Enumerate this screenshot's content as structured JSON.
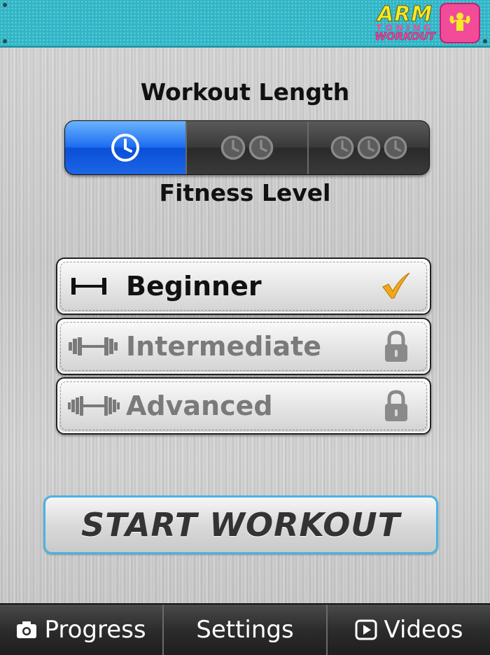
{
  "app": {
    "logo": {
      "line1": "ARM",
      "line2": "TONING",
      "line3": "WORKOUT"
    }
  },
  "workout_length": {
    "title": "Workout Length",
    "options": [
      {
        "icon": "clock-icon",
        "clocks": 1,
        "selected": true
      },
      {
        "icon": "clock-icon",
        "clocks": 2,
        "selected": false
      },
      {
        "icon": "clock-icon",
        "clocks": 3,
        "selected": false
      }
    ]
  },
  "fitness_level": {
    "title": "Fitness Level",
    "levels": [
      {
        "label": "Beginner",
        "icon": "dumbbell-icon",
        "status": "check-icon",
        "locked": false
      },
      {
        "label": "Intermediate",
        "icon": "dumbbell-icon",
        "status": "lock-icon",
        "locked": true
      },
      {
        "label": "Advanced",
        "icon": "dumbbell-icon",
        "status": "lock-icon",
        "locked": true
      }
    ]
  },
  "start_button": {
    "label": "START WORKOUT"
  },
  "tabbar": {
    "items": [
      {
        "label": "Progress",
        "icon": "camera-icon"
      },
      {
        "label": "Settings",
        "icon": ""
      },
      {
        "label": "Videos",
        "icon": "play-icon"
      }
    ]
  },
  "colors": {
    "accent_blue": "#1e6ef0",
    "header_teal": "#2fb6c7",
    "check_orange": "#f2a81c",
    "button_border": "#4ab3e2"
  }
}
